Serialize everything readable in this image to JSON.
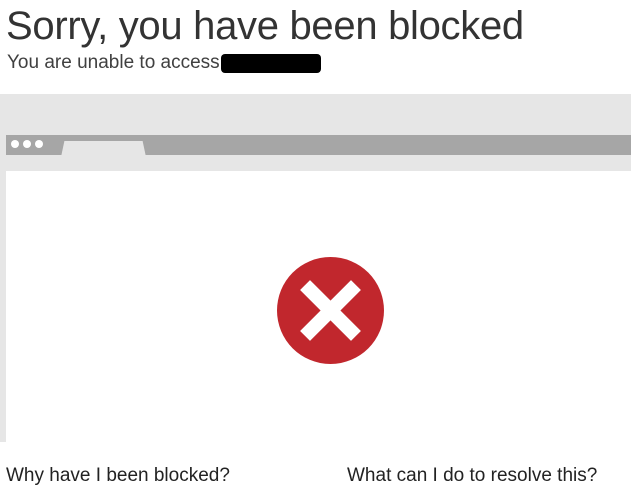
{
  "header": {
    "title": "Sorry, you have been blocked",
    "subtitle": "You are unable to access"
  },
  "illustration": {
    "status_icon": "error-x-circle-icon",
    "error_color": "#c1272d",
    "window_dots_icon": "window-controls-icon"
  },
  "footer": {
    "why_label": "Why have I been blocked?",
    "resolve_label": "What can I do to resolve this?"
  },
  "colors": {
    "band_background": "#e6e6e6",
    "browser_bar": "#a6a6a6",
    "redaction": "#000000"
  }
}
